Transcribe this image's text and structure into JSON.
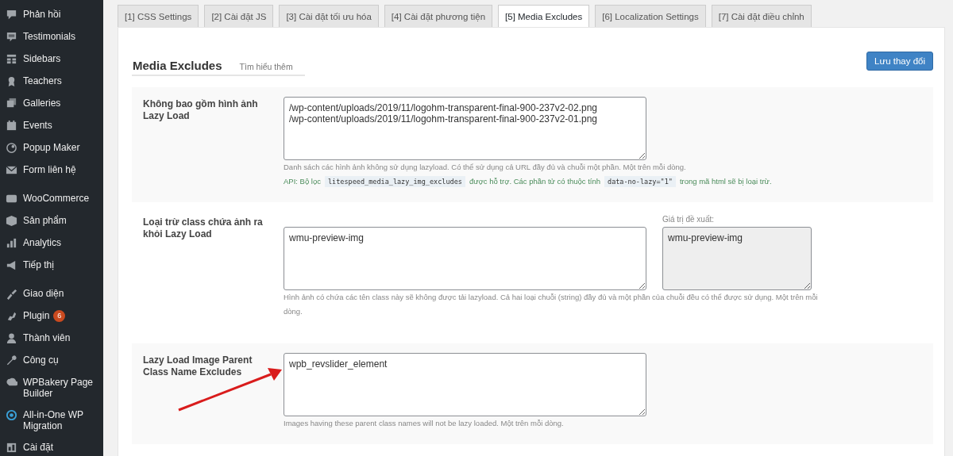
{
  "sidebar": {
    "groups": [
      {
        "items": [
          {
            "label": "Phản hồi"
          },
          {
            "label": "Testimonials"
          },
          {
            "label": "Sidebars"
          },
          {
            "label": "Teachers"
          },
          {
            "label": "Galleries"
          },
          {
            "label": "Events"
          },
          {
            "label": "Popup Maker"
          },
          {
            "label": "Form liên hệ"
          }
        ]
      },
      {
        "items": [
          {
            "label": "WooCommerce"
          },
          {
            "label": "Sản phẩm"
          },
          {
            "label": "Analytics"
          },
          {
            "label": "Tiếp thị"
          }
        ]
      },
      {
        "items": [
          {
            "label": "Giao diện"
          },
          {
            "label": "Plugin",
            "badge": "6"
          },
          {
            "label": "Thành viên"
          },
          {
            "label": "Công cụ"
          },
          {
            "label": "WPBakery Page Builder"
          },
          {
            "label": "All-in-One WP Migration"
          },
          {
            "label": "Cài đặt"
          }
        ]
      }
    ]
  },
  "tabs": [
    {
      "label": "[1] CSS Settings",
      "selected": false
    },
    {
      "label": "[2] Cài đặt JS",
      "selected": false
    },
    {
      "label": "[3] Cài đặt tối ưu hóa",
      "selected": false
    },
    {
      "label": "[4] Cài đặt phương tiện",
      "selected": false
    },
    {
      "label": "[5] Media Excludes",
      "selected": true
    },
    {
      "label": "[6] Localization Settings",
      "selected": false
    },
    {
      "label": "[7] Cài đặt điều chỉnh",
      "selected": false
    }
  ],
  "section": {
    "title": "Media Excludes",
    "link": "Tìm hiểu thêm",
    "save_button": "Lưu thay đổi"
  },
  "settings": [
    {
      "label": "Không bao gồm hình ảnh Lazy Load",
      "value": "/wp-content/uploads/2019/11/logohm-transparent-final-900-237v2-02.png\n/wp-content/uploads/2019/11/logohm-transparent-final-900-237v2-01.png",
      "notes": [
        [
          {
            "kind": "text",
            "text": "Danh sách các hình ảnh không sử dụng lazyload. Có thể sử dụng cả URL đầy đủ và chuỗi một phần. Một trên mỗi dòng."
          }
        ],
        [
          {
            "kind": "api",
            "text": "API: Bộ lọc"
          },
          {
            "kind": "code",
            "text": "litespeed_media_lazy_img_excludes"
          },
          {
            "kind": "api",
            "text": "được hỗ trợ. Các phần tử có thuộc tính"
          },
          {
            "kind": "code",
            "text": "data-no-lazy=\"1\""
          },
          {
            "kind": "api",
            "text": "trong mã html sẽ bị loại trừ."
          }
        ]
      ]
    },
    {
      "label": "Loại trừ class chứa ảnh ra khỏi Lazy Load",
      "value": "wmu-preview-img",
      "suggested": {
        "caption": "Giá trị đề xuất:",
        "value": "wmu-preview-img"
      },
      "notes": [
        [
          {
            "kind": "text",
            "text": "Hình ảnh có chứa các tên class này sẽ không được tải lazyload. Cả hai loại chuỗi (string) đầy đủ và một phần của chuỗi đều có thể được sử dụng. Một trên mỗi dòng."
          }
        ]
      ]
    },
    {
      "label": "Lazy Load Image Parent Class Name Excludes",
      "value": "wpb_revslider_element",
      "arrow": true,
      "notes": [
        [
          {
            "kind": "text",
            "text": "Images having these parent class names will not be lazy loaded. Một trên mỗi dòng."
          }
        ]
      ]
    }
  ]
}
